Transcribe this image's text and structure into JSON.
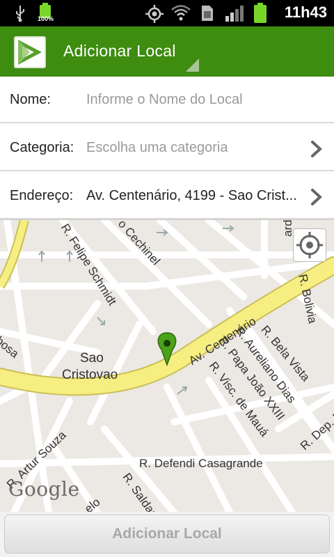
{
  "status_bar": {
    "time": "11h43",
    "battery_small_label": "100%",
    "icons": [
      "usb-icon",
      "battery-charging-icon",
      "gps-icon",
      "wifi-icon",
      "sim-icon",
      "signal-icon",
      "battery-icon"
    ]
  },
  "action_bar": {
    "title": "Adicionar Local",
    "logo_icon": "app-logo-play-icon"
  },
  "form": {
    "name": {
      "label": "Nome:",
      "placeholder": "Informe o Nome do Local"
    },
    "category": {
      "label": "Categoria:",
      "value": "Escolha uma categoria"
    },
    "address": {
      "label": "Endereço:",
      "value": "Av. Centenário, 4199 - Sao Crist..."
    }
  },
  "map": {
    "streets": {
      "felipe_schmidt": "R. Felipe Schmidt",
      "cechinel": "o Cechinel",
      "bolivia": "R. Bolivia",
      "bela_vista": "R. Bela Vista",
      "aureliano_dias": "R. Aureliano Dias",
      "papa_joao": "R. Papa João XXIII",
      "visc_maua": "R. Visc. de Mauá",
      "dep": "R. Dep. I",
      "centenario": "Av. Centenário",
      "barbosa": "rbosa",
      "artur_souza": "R. Artur Souza",
      "defendi": "R. Defendi Casagrande",
      "saldanha": "R. Saldan",
      "elo": "elo",
      "ardi": "ardi"
    },
    "district_line1": "Sao",
    "district_line2": "Cristovao",
    "attribution": "Google",
    "colors": {
      "major_road": "#f7ee82",
      "minor_road": "#ffffff",
      "block": "#ece8e4",
      "pin": "#4aa318"
    }
  },
  "bottom": {
    "add_button_label": "Adicionar Local"
  },
  "colors": {
    "action_bar": "#3e8c10",
    "status_bar": "#000000"
  }
}
